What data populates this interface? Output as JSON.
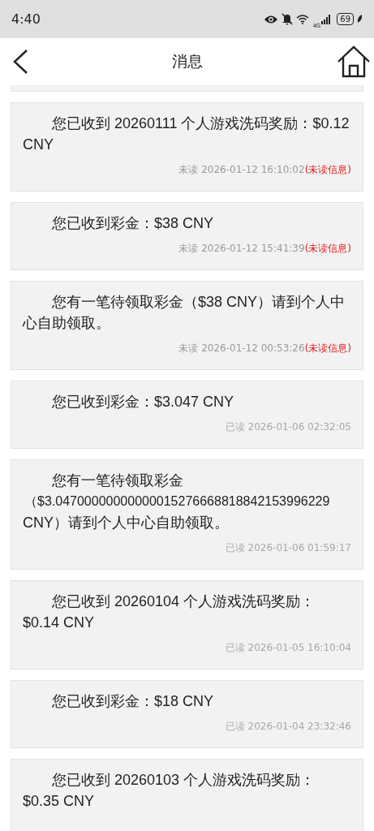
{
  "status_bar": {
    "time": "4:40",
    "network": "4G",
    "battery": "69"
  },
  "header": {
    "title": "消息"
  },
  "messages": [
    {
      "text": "您已收到 20260111 个人游戏洗码奖励：$0.12 CNY",
      "status": "未读",
      "time": "2026-01-12 16:10:02",
      "unread": true,
      "unread_label": "(未读信息)"
    },
    {
      "text": "您已收到彩金：$38 CNY",
      "status": "未读",
      "time": "2026-01-12 15:41:39",
      "unread": true,
      "unread_label": "(未读信息)"
    },
    {
      "text": "您有一笔待领取彩金（$38 CNY）请到个人中心自助领取。",
      "status": "未读",
      "time": "2026-01-12 00:53:26",
      "unread": true,
      "unread_label": "(未读信息)"
    },
    {
      "text": "您已收到彩金：$3.047 CNY",
      "status": "已读",
      "time": "2026-01-06 02:32:05",
      "unread": false
    },
    {
      "lines": [
        "您有一笔待领取彩金",
        "（$3.04700000000000015276668818842153996229",
        "CNY）请到个人中心自助领取。"
      ],
      "status": "已读",
      "time": "2026-01-06 01:59:17",
      "unread": false
    },
    {
      "text": "您已收到 20260104 个人游戏洗码奖励：$0.14 CNY",
      "status": "已读",
      "time": "2026-01-05 16:10:04",
      "unread": false
    },
    {
      "text": "您已收到彩金：$18 CNY",
      "status": "已读",
      "time": "2026-01-04 23:32:46",
      "unread": false
    },
    {
      "text": "您已收到 20260103 个人游戏洗码奖励：$0.35 CNY"
    }
  ]
}
